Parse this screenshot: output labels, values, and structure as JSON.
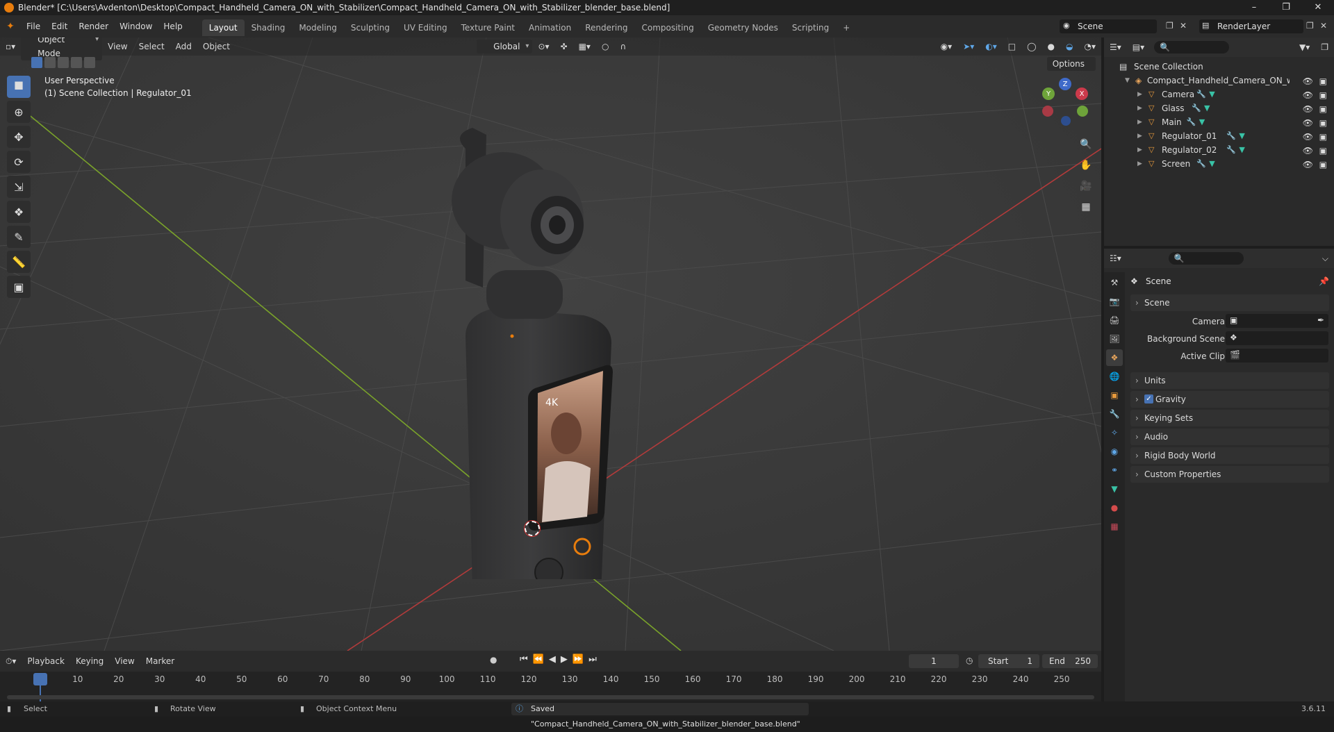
{
  "window": {
    "title": "Blender* [C:\\Users\\Avdenton\\Desktop\\Compact_Handheld_Camera_ON_with_Stabilizer\\Compact_Handheld_Camera_ON_with_Stabilizer_blender_base.blend]"
  },
  "menu": [
    "File",
    "Edit",
    "Render",
    "Window",
    "Help"
  ],
  "workspaces": [
    "Layout",
    "Shading",
    "Modeling",
    "Sculpting",
    "UV Editing",
    "Texture Paint",
    "Animation",
    "Rendering",
    "Compositing",
    "Geometry Nodes",
    "Scripting"
  ],
  "active_workspace": "Layout",
  "scene_selector": "Scene",
  "renderlayer_selector": "RenderLayer",
  "viewport": {
    "mode": "Object Mode",
    "menus": [
      "View",
      "Select",
      "Add",
      "Object"
    ],
    "transform": "Global",
    "options": "Options",
    "perspective": "User Perspective",
    "collection_info": "(1) Scene Collection | Regulator_01",
    "screen_badge": "4K",
    "accent": "#4772b3",
    "x_axis_color": "#b23b3b",
    "y_axis_color": "#7aa32a"
  },
  "outliner": {
    "root": "Scene Collection",
    "collection": "Compact_Handheld_Camera_ON_with_S",
    "objects": [
      "Camera",
      "Glass",
      "Main",
      "Regulator_01",
      "Regulator_02",
      "Screen"
    ]
  },
  "properties": {
    "header": "Scene",
    "section": "Scene",
    "fields": [
      "Camera",
      "Background Scene",
      "Active Clip"
    ],
    "panels": [
      "Units",
      "Gravity",
      "Keying Sets",
      "Audio",
      "Rigid Body World",
      "Custom Properties"
    ]
  },
  "timeline": {
    "menus": [
      "Playback",
      "Keying",
      "View",
      "Marker"
    ],
    "current_frame": "1",
    "start_label": "Start",
    "start": "1",
    "end_label": "End",
    "end": "250",
    "ticks": [
      "1",
      "10",
      "20",
      "30",
      "40",
      "50",
      "60",
      "70",
      "80",
      "90",
      "100",
      "110",
      "120",
      "130",
      "140",
      "150",
      "160",
      "170",
      "180",
      "190",
      "200",
      "210",
      "220",
      "230",
      "240",
      "250"
    ]
  },
  "status": {
    "select": "Select",
    "rotate": "Rotate View",
    "context": "Object Context Menu",
    "message": "Saved \"Compact_Handheld_Camera_ON_with_Stabilizer_blender_base.blend\"",
    "version": "3.6.11"
  }
}
